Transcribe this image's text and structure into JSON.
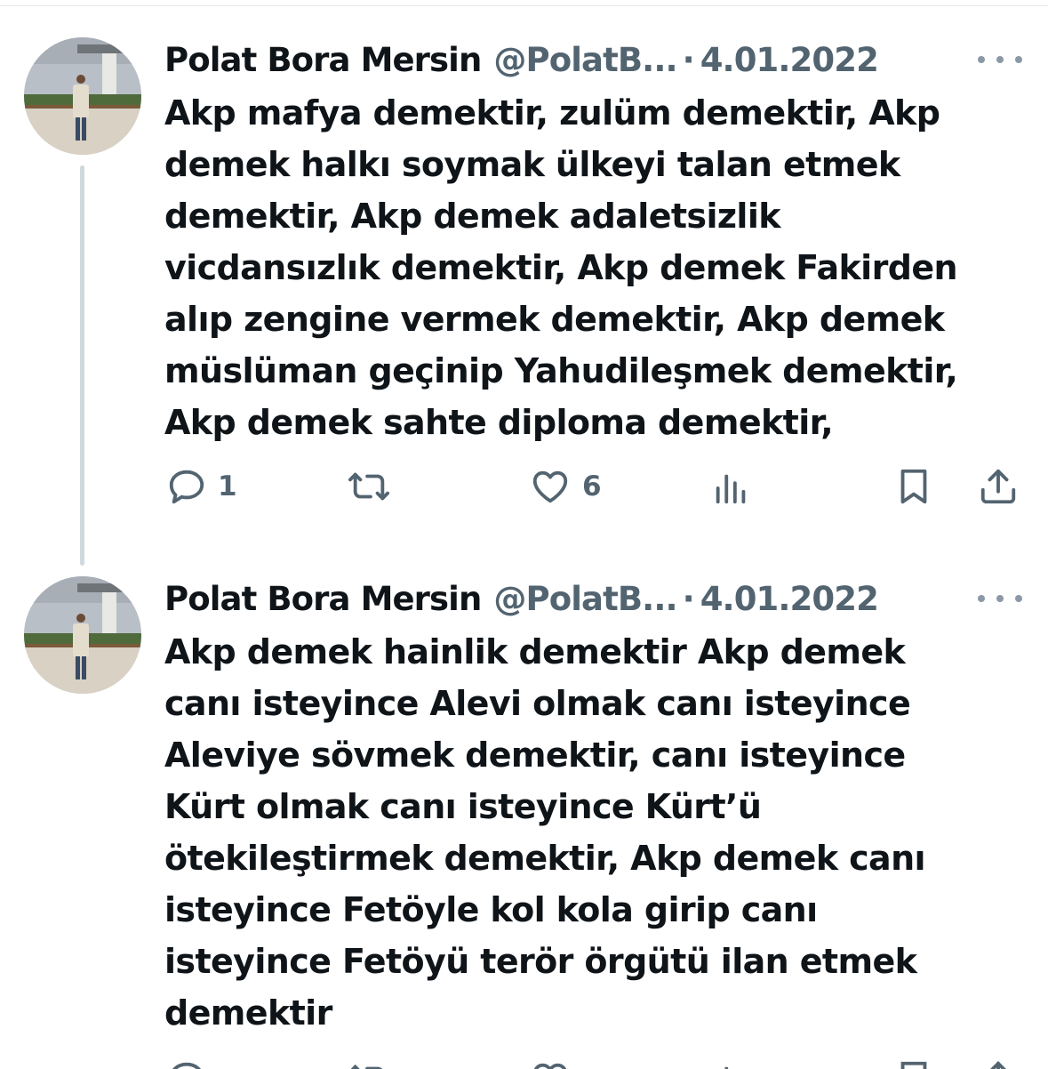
{
  "tweets": [
    {
      "name": "Polat Bora Mersin",
      "handle": "@PolatB...",
      "separator": "·",
      "date": "4.01.2022",
      "text": "Akp mafya demektir, zulüm demektir, Akp\ndemek halkı soymak ülkeyi talan etmek\ndemektir, Akp demek adaletsizlik\nvicdansızlık demektir, Akp demek Fakirden\nalıp zengine vermek demektir, Akp demek\nmüslüman geçinip Yahudileşmek demektir,\nAkp demek sahte diploma demektir,",
      "reply_count": "1",
      "like_count": "6"
    },
    {
      "name": "Polat Bora Mersin",
      "handle": "@PolatB...",
      "separator": "·",
      "date": "4.01.2022",
      "text": "Akp demek hainlik demektir  Akp demek\ncanı isteyince Alevi olmak canı isteyince\nAleviye sövmek demektir, canı isteyince\nKürt olmak canı isteyince Kürt’ü\nötekileştirmek demektir, Akp demek canı\nisteyince Fetöyle kol kola girip canı\nisteyince Fetöyü terör örgütü ilan etmek\ndemektir"
    }
  ],
  "icons": {
    "reply": "reply-icon",
    "retweet": "retweet-icon",
    "like": "heart-icon",
    "views": "views-icon",
    "bookmark": "bookmark-icon",
    "share": "share-icon",
    "more": "more-icon"
  },
  "colors": {
    "text": "#0f1419",
    "secondary": "#536471",
    "thread_line": "#cfd9de",
    "background": "#ffffff"
  }
}
